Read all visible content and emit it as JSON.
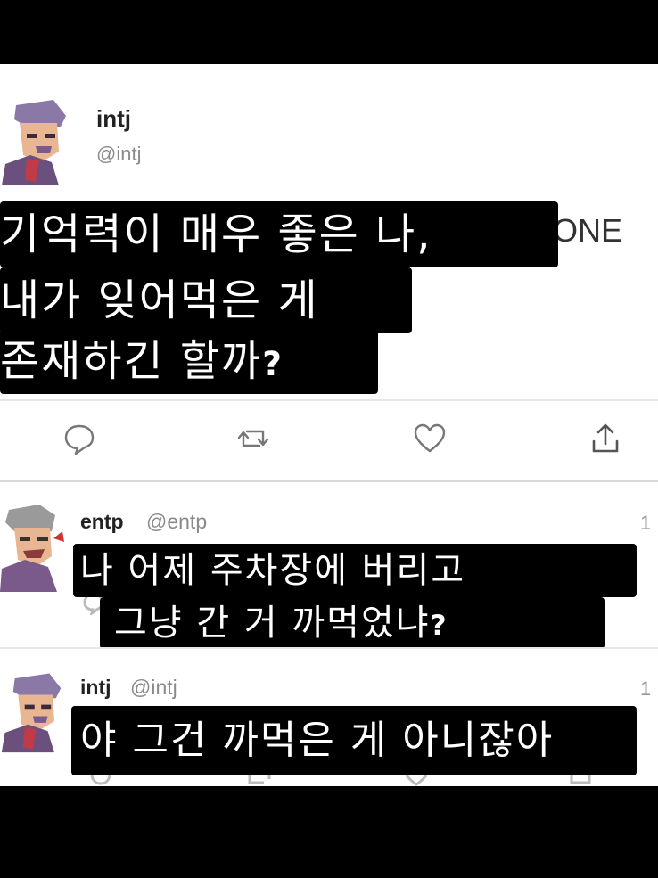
{
  "tweets": [
    {
      "name": "intj",
      "handle": "@intj",
      "avatar_icon": "intj-character-avatar",
      "residue_text": "ONE",
      "caption_lines": [
        "기억력이 매우 좋은 나,",
        "내가 잊어먹은 게",
        "존재하긴 할까"
      ],
      "caption_end_mark": "?"
    },
    {
      "name": "entp",
      "handle": "@entp",
      "time": "1",
      "avatar_icon": "entp-character-avatar",
      "caption_lines": [
        "나 어제 주차장에 버리고",
        "그냥 간 거 까먹었냐"
      ],
      "caption_end_mark": "?"
    },
    {
      "name": "intj",
      "handle": "@intj",
      "time": "1",
      "avatar_icon": "intj-character-avatar",
      "caption_lines": [
        "야 그건 까먹은 게 아니잖아"
      ]
    }
  ],
  "actions": [
    "reply-icon",
    "retweet-icon",
    "like-icon",
    "share-icon"
  ],
  "colors": {
    "caption_bg": "#000000",
    "caption_text": "#ffffff",
    "frame": "#000000",
    "card": "#ffffff"
  }
}
